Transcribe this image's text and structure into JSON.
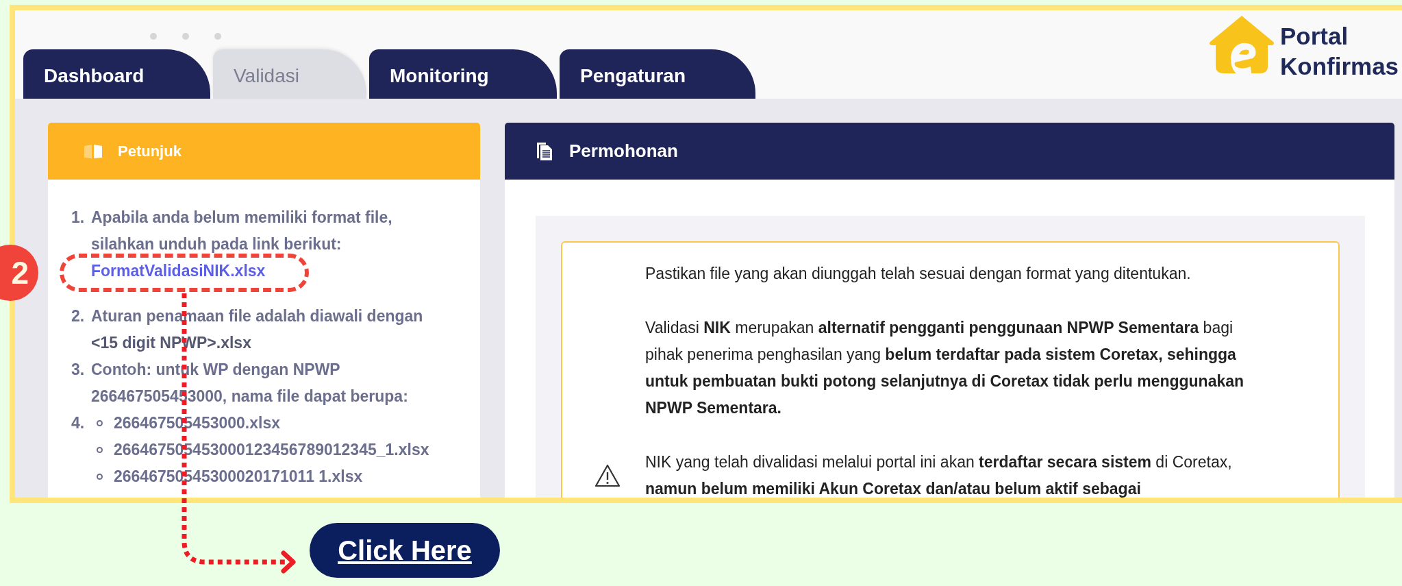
{
  "tabs": [
    {
      "label": "Dashboard",
      "selected": false
    },
    {
      "label": "Validasi",
      "selected": true
    },
    {
      "label": "Monitoring",
      "selected": false
    },
    {
      "label": "Pengaturan",
      "selected": false
    }
  ],
  "logo": {
    "lines": [
      "Portal",
      "Konfirmas"
    ]
  },
  "petunjuk": {
    "title": "Petunjuk",
    "items": [
      {
        "number": "1.",
        "text": "Apabila anda belum memiliki format file, silahkan unduh pada link berikut:",
        "link": "FormatValidasiNIK.xlsx"
      },
      {
        "number": "2.",
        "text": "Aturan penamaan file adalah diawali dengan **<15 digit NPWP>.xlsx**"
      },
      {
        "number": "3.",
        "text": "Contoh: untuk WP dengan NPWP 266467505453000, nama file dapat berupa:"
      },
      {
        "number": "4.",
        "examples": [
          "266467505453000.xlsx",
          "266467505453000123456789012345_1.xlsx",
          "26646750545300020171011 1.xlsx"
        ]
      }
    ]
  },
  "permohonan": {
    "title": "Permohonan",
    "paragraphs": [
      {
        "kind": "plain",
        "text": "Pastikan file yang akan diunggah telah sesuai dengan format yang ditentukan."
      },
      {
        "kind": "plain",
        "text": "Validasi **NIK** merupakan **alternatif pengganti penggunaan NPWP Sementara** bagi pihak penerima penghasilan yang **belum terdaftar pada sistem Coretax, sehingga untuk pembuatan bukti potong selanjutnya di Coretax tidak perlu menggunakan NPWP Sementara.**"
      },
      {
        "kind": "warning",
        "text": "NIK yang telah divalidasi melalui portal ini akan **terdaftar secara sistem** di Coretax, **namun belum memiliki Akun Coretax dan/atau belum aktif sebagai**"
      }
    ]
  },
  "annotation": {
    "step": "2",
    "button": "Click Here"
  }
}
